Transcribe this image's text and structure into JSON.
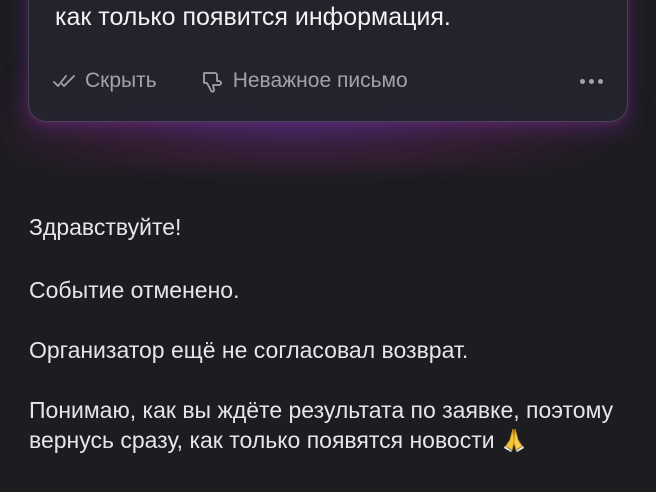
{
  "card": {
    "text": "как только появится информация.",
    "actions": {
      "hide_label": "Скрыть",
      "hide_icon": "double-check-icon",
      "unimportant_label": "Неважное письмо",
      "unimportant_icon": "thumbs-down-icon",
      "more_icon": "more-horizontal-icon"
    },
    "accent_colors": [
      "#763abe",
      "#c83c8c"
    ]
  },
  "message": {
    "paragraphs": [
      "Здравствуйте!",
      "Событие отменено.",
      "Организатор ещё не согласовал возврат.",
      "Понимаю, как вы ждёте результата по заявке, поэтому вернусь сразу, как только появятся новости"
    ],
    "emoji": "folded-hands-icon"
  }
}
